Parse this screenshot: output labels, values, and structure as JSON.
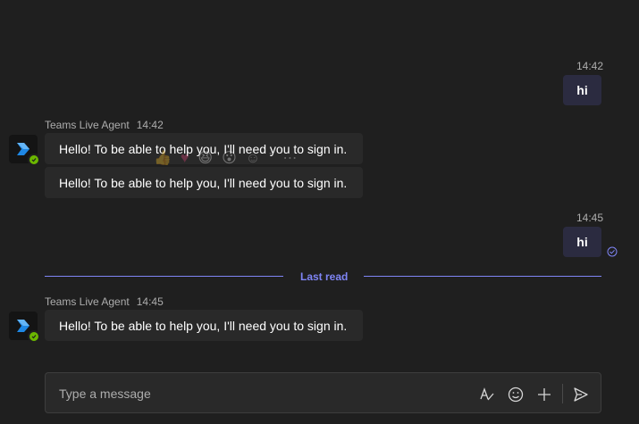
{
  "conversation": {
    "messages": [
      {
        "direction": "outgoing",
        "time": "14:42",
        "text": "hi"
      },
      {
        "direction": "incoming",
        "sender": "Teams Live Agent",
        "time": "14:42",
        "texts": [
          "Hello! To be able to help you, I'll need you to sign in.",
          "Hello! To be able to help you, I'll need you to sign in."
        ]
      },
      {
        "direction": "outgoing",
        "time": "14:45",
        "text": "hi"
      },
      {
        "direction": "incoming",
        "sender": "Teams Live Agent",
        "time": "14:45",
        "texts": [
          "Hello! To be able to help you, I'll need you to sign in."
        ]
      }
    ],
    "last_read_label": "Last read"
  },
  "reactions": [
    "like-icon",
    "heart-icon",
    "laugh-icon",
    "surprised-icon",
    "add-reaction-icon",
    "quote-icon",
    "more-options-icon"
  ],
  "composer": {
    "placeholder": "Type a message"
  },
  "colors": {
    "background": "#1f1f1f",
    "outgoing_bubble": "#2b2b40",
    "incoming_bubble": "#292929",
    "accent": "#7f85f5",
    "presence": "#6bb700"
  }
}
